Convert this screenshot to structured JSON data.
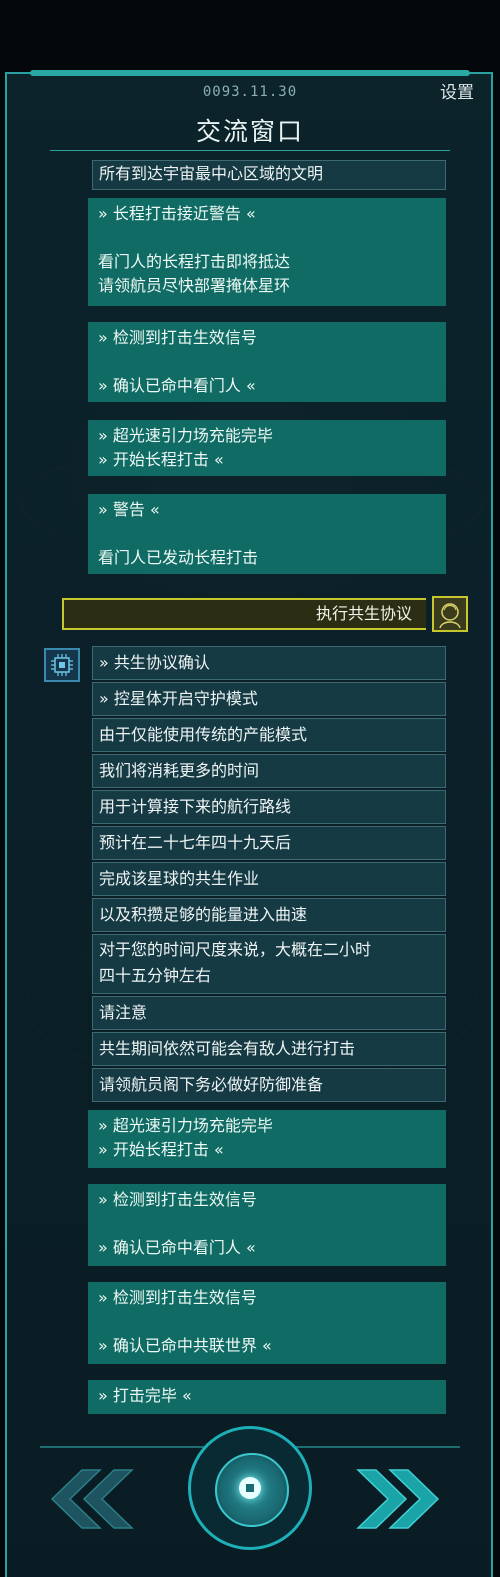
{
  "header": {
    "date": "0093.11.30",
    "settings_label": "设置",
    "title": "交流窗口"
  },
  "messages_top": {
    "cutoff": "所有到达宇宙最中心区域的文明",
    "m1": {
      "line1": "» 长程打击接近警告 «",
      "line2": "看门人的长程打击即将抵达",
      "line3": "请领航员尽快部署掩体星环"
    },
    "m2": {
      "line1": "» 检测到打击生效信号",
      "line2": "» 确认已命中看门人 «"
    },
    "m3": {
      "line1": "» 超光速引力场充能完毕",
      "line2": "» 开始长程打击 «"
    },
    "m4": {
      "line1": "» 警告 «",
      "line2": "看门人已发动长程打击"
    }
  },
  "player_choice": {
    "label": "执行共生协议"
  },
  "dialog_rows": [
    "» 共生协议确认",
    "» 控星体开启守护模式",
    "由于仅能使用传统的产能模式",
    "我们将消耗更多的时间",
    "用于计算接下来的航行路线",
    "预计在二十七年四十九天后",
    "完成该星球的共生作业",
    "以及积攒足够的能量进入曲速",
    "对于您的时间尺度来说，大概在二小时",
    "四十五分钟左右",
    "请注意",
    "共生期间依然可能会有敌人进行打击",
    "请领航员阁下务必做好防御准备"
  ],
  "messages_bottom": {
    "m5": {
      "line1": "» 超光速引力场充能完毕",
      "line2": "» 开始长程打击 «"
    },
    "m6": {
      "line1": "» 检测到打击生效信号",
      "line2": "» 确认已命中看门人 «"
    },
    "m7": {
      "line1": "» 检测到打击生效信号",
      "line2": "» 确认已命中共联世界 «"
    },
    "m8": {
      "line1": "» 打击完毕 «"
    }
  },
  "icons": [
    "chip-icon",
    "commander-avatar-icon",
    "prev-page-icon",
    "next-page-icon",
    "center-action-icon"
  ],
  "colors": {
    "accent": "#2aa1a1",
    "message_bg": "#0f6b64",
    "row_bg": "#163a44",
    "choice_border": "#c7c92a"
  }
}
